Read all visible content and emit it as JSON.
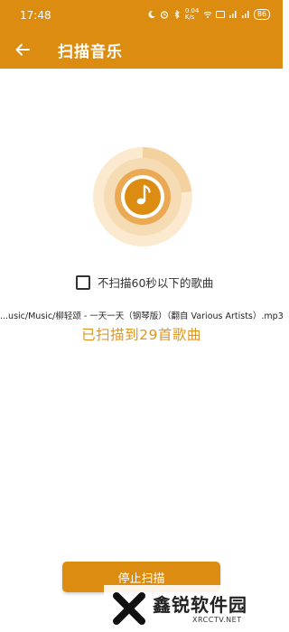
{
  "status_bar": {
    "time": "17:48",
    "network_speed": "0.04 K/s",
    "battery": "86"
  },
  "app_bar": {
    "title": "扫描音乐"
  },
  "scan": {
    "checkbox_label": "不扫描60秒以下的歌曲",
    "checkbox_checked": false,
    "current_path": "...usic/Music/柳轻颂 - 一天一天（钢琴版）（翻自 Various Artists）.mp3",
    "status_text": "已扫描到29首歌曲",
    "stop_button_label": "停止扫描"
  },
  "watermark": {
    "name": "鑫锐软件园",
    "url": "XRCCTV.NET"
  },
  "colors": {
    "accent": "#dc8c10",
    "status_text": "#e0961e"
  },
  "icons": {
    "back": "arrow-left-icon",
    "music": "music-note-icon"
  }
}
